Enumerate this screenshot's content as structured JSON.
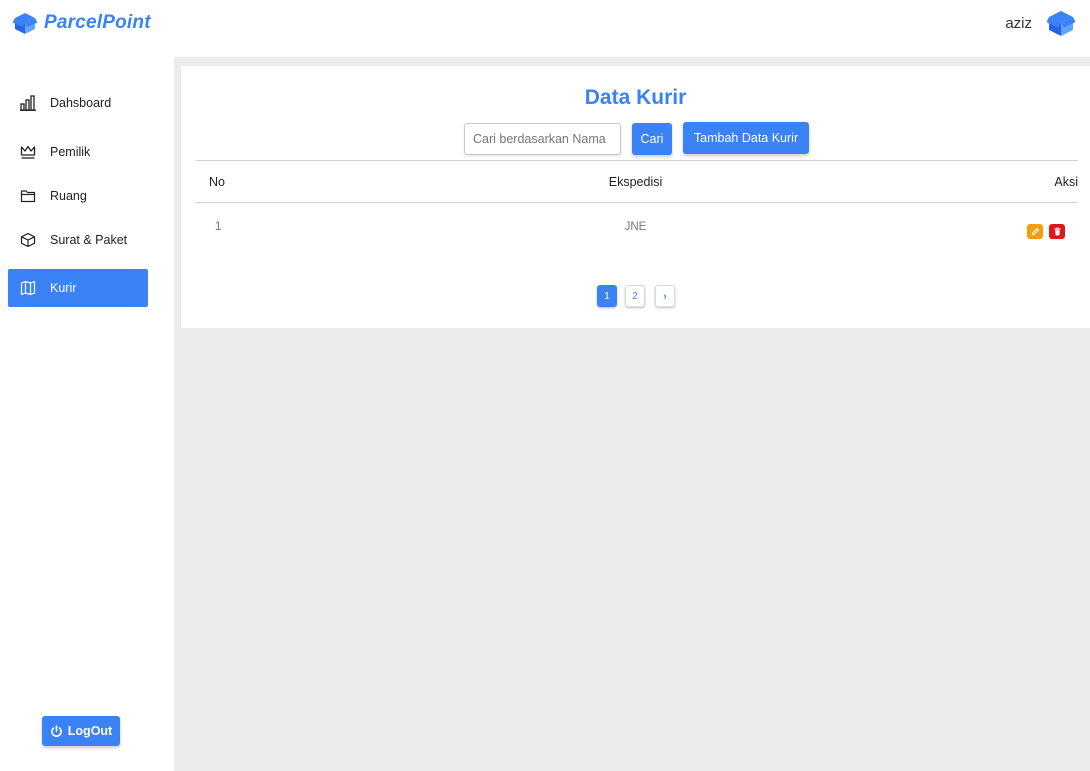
{
  "brand": {
    "name": "ParcelPoint",
    "color": "#3b82f6"
  },
  "user": {
    "name": "aziz"
  },
  "sidebar": {
    "items": [
      {
        "label": "Dahsboard",
        "icon": "bar-chart-icon"
      },
      {
        "label": "Pemilik",
        "icon": "crown-icon"
      },
      {
        "label": "Ruang",
        "icon": "folder-icon"
      },
      {
        "label": "Surat & Paket",
        "icon": "package-icon"
      },
      {
        "label": "Kurir",
        "icon": "map-icon",
        "active": true
      }
    ],
    "logout_label": "LogOut"
  },
  "main": {
    "title": "Data Kurir",
    "search": {
      "placeholder": "Cari berdasarkan Nama"
    },
    "search_button": "Cari",
    "add_button": "Tambah Data Kurir",
    "table": {
      "headers": [
        "No",
        "Ekspedisi",
        "Aksi"
      ],
      "rows": [
        {
          "no": "1",
          "ekspedisi": "JNE"
        }
      ]
    },
    "pagination": {
      "pages": [
        "1",
        "2"
      ],
      "current": "1",
      "next": "›"
    }
  },
  "colors": {
    "accent": "#3b82f6",
    "edit": "#f59e0b",
    "delete": "#e01818",
    "background": "#ececec"
  }
}
